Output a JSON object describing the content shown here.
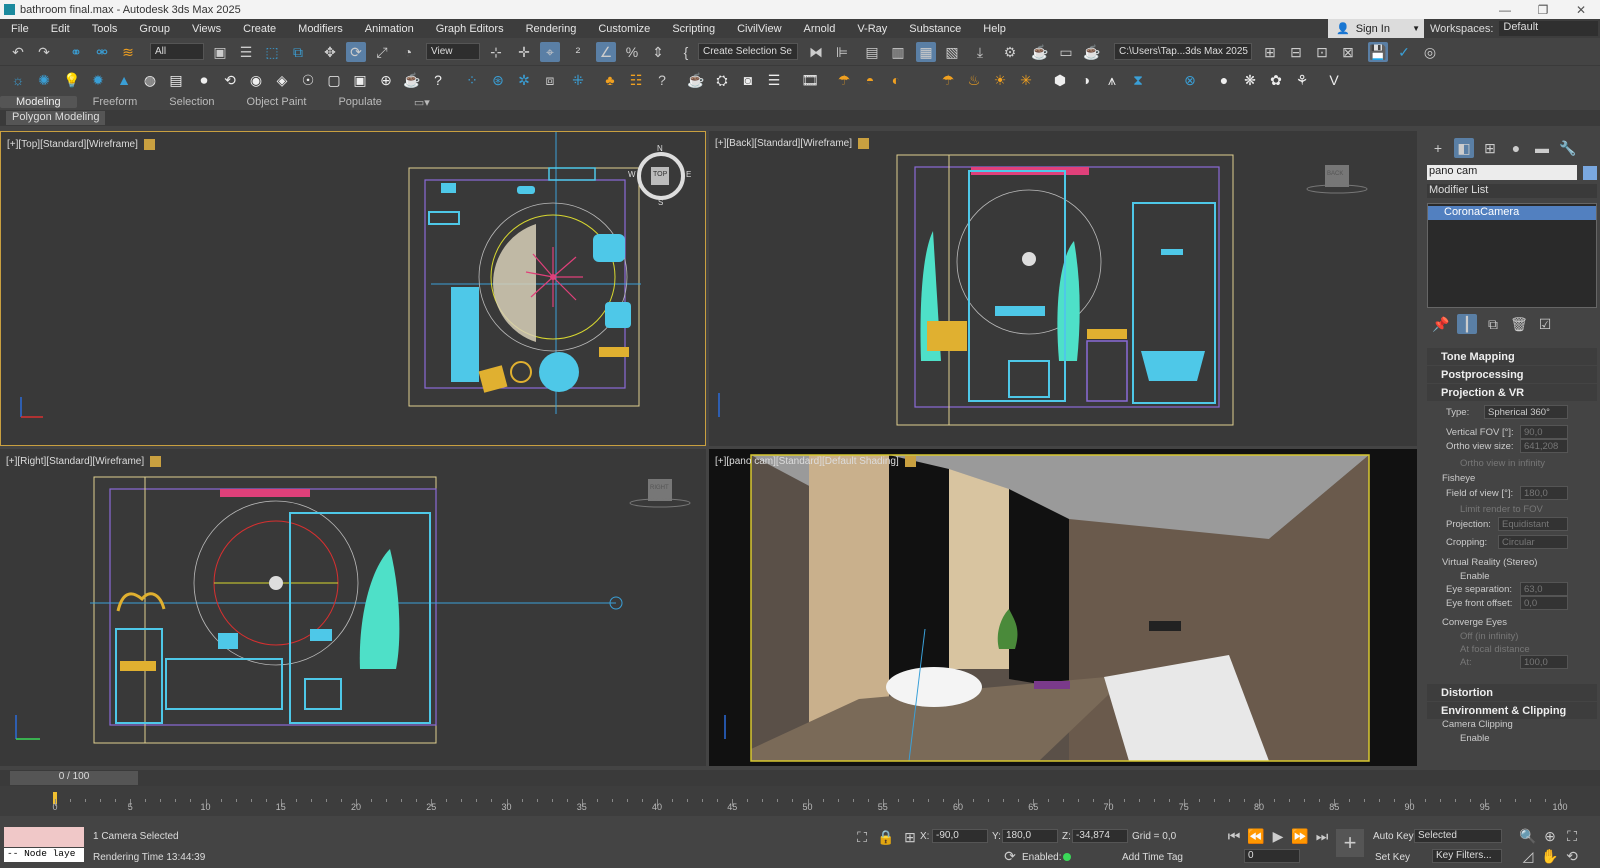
{
  "title": "bathroom final.max - Autodesk 3ds Max 2025",
  "menu": [
    "File",
    "Edit",
    "Tools",
    "Group",
    "Views",
    "Create",
    "Modifiers",
    "Animation",
    "Graph Editors",
    "Rendering",
    "Customize",
    "Scripting",
    "CivilView",
    "Arnold",
    "V-Ray",
    "Substance",
    "Help"
  ],
  "signin": "Sign In",
  "workspaces_label": "Workspaces:",
  "workspace": "Default",
  "toolbar": {
    "selection_filter": "All",
    "ref_coord": "View",
    "selection_set": "Create Selection Se",
    "project_path": "C:\\Users\\Tap...3ds Max 2025"
  },
  "ribbon_tabs": [
    "Modeling",
    "Freeform",
    "Selection",
    "Object Paint",
    "Populate"
  ],
  "ribbon_sub": "Polygon Modeling",
  "viewports": {
    "top": "[+][Top][Standard][Wireframe]",
    "back": "[+][Back][Standard][Wireframe]",
    "right": "[+][Right][Standard][Wireframe]",
    "cam": "[+][pano cam][Standard][Default Shading]",
    "viewcube_top": "TOP",
    "viewcube_back": "BACK",
    "viewcube_right": "RIGHT",
    "compass": [
      "N",
      "E",
      "S",
      "W"
    ]
  },
  "panel": {
    "object_name": "pano cam",
    "modifier_list": "Modifier List",
    "stack_item": "CoronaCamera",
    "rollouts": [
      "Tone Mapping",
      "Postprocessing",
      "Projection & VR",
      "Distortion",
      "Environment & Clipping"
    ],
    "type_label": "Type:",
    "type_value": "Spherical 360°",
    "vfov_label": "Vertical FOV [°]:",
    "vfov_value": "90,0",
    "ortho_label": "Ortho view size:",
    "ortho_value": "641,208",
    "ortho_inf": "Ortho view in infinity",
    "fisheye": "Fisheye",
    "fov_label": "Field of view [°]:",
    "fov_value": "180,0",
    "limit_fov": "Limit render to FOV",
    "projection_label": "Projection:",
    "projection_value": "Equidistant",
    "cropping_label": "Cropping:",
    "cropping_value": "Circular",
    "vr_group": "Virtual Reality (Stereo)",
    "enable": "Enable",
    "eye_sep_label": "Eye separation:",
    "eye_sep_value": "63,0",
    "eye_front_label": "Eye front offset:",
    "eye_front_value": "0,0",
    "converge": "Converge Eyes",
    "off_inf": "Off (in infinity)",
    "focal": "At focal distance",
    "at_label": "At:",
    "at_value": "100,0",
    "cam_clipping": "Camera Clipping",
    "clip_enable": "Enable"
  },
  "timeline": {
    "slider": "0 / 100",
    "ticks": [
      "0",
      "5",
      "10",
      "15",
      "20",
      "25",
      "30",
      "35",
      "40",
      "45",
      "50",
      "55",
      "60",
      "65",
      "70",
      "75",
      "80",
      "85",
      "90",
      "95",
      "100"
    ]
  },
  "status": {
    "node_layer": "-- Node laye",
    "selected": "1 Camera Selected",
    "render_time": "Rendering Time 13:44:39",
    "x_label": "X:",
    "x": "-90,0",
    "y_label": "Y:",
    "y": "180,0",
    "z_label": "Z:",
    "z": "-34,874",
    "grid": "Grid = 0,0",
    "enabled": "Enabled:",
    "add_time_tag": "Add Time Tag",
    "auto_key": "Auto Key",
    "set_key": "Set Key",
    "key_mode": "Selected",
    "key_filters": "Key Filters...",
    "frame": "0"
  }
}
